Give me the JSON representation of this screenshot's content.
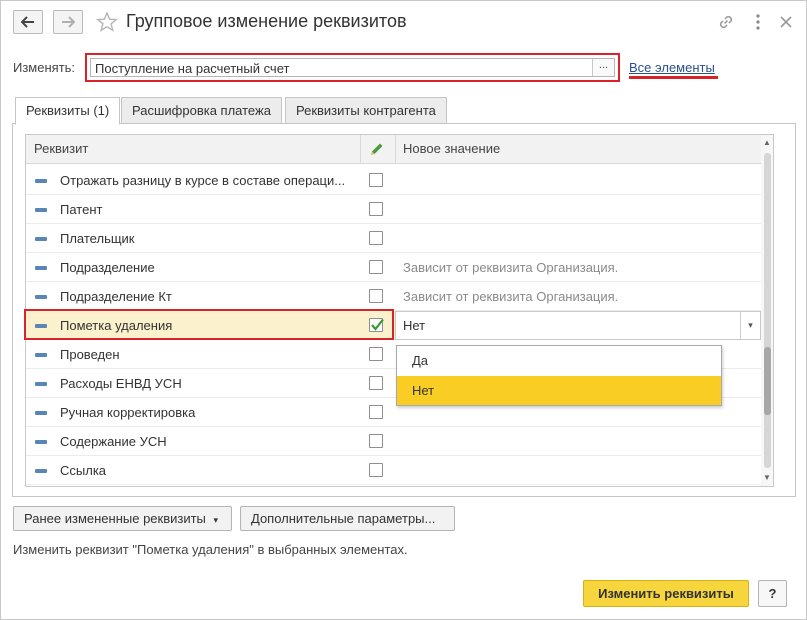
{
  "window": {
    "title": "Групповое изменение реквизитов"
  },
  "edit_row": {
    "label": "Изменять:",
    "value": "Поступление на расчетный счет",
    "choose_button": "...",
    "all_elements_link": "Все элементы"
  },
  "tabs": [
    {
      "label": "Реквизиты (1)",
      "active": true
    },
    {
      "label": "Расшифровка платежа",
      "active": false
    },
    {
      "label": "Реквизиты контрагента",
      "active": false
    }
  ],
  "table": {
    "columns": {
      "name": "Реквизит",
      "new_value": "Новое значение"
    },
    "rows": [
      {
        "name": "Отражать разницу в курсе в составе операци...",
        "checked": false,
        "value": ""
      },
      {
        "name": "Патент",
        "checked": false,
        "value": ""
      },
      {
        "name": "Плательщик",
        "checked": false,
        "value": ""
      },
      {
        "name": "Подразделение",
        "checked": false,
        "value": "Зависит от реквизита Организация."
      },
      {
        "name": "Подразделение Кт",
        "checked": false,
        "value": "Зависит от реквизита Организация."
      },
      {
        "name": "Пометка удаления",
        "checked": true,
        "value": "Нет"
      },
      {
        "name": "Проведен",
        "checked": false,
        "value": ""
      },
      {
        "name": "Расходы ЕНВД УСН",
        "checked": false,
        "value": ""
      },
      {
        "name": "Ручная корректировка",
        "checked": false,
        "value": ""
      },
      {
        "name": "Содержание УСН",
        "checked": false,
        "value": ""
      },
      {
        "name": "Ссылка",
        "checked": false,
        "value": ""
      }
    ]
  },
  "dropdown": {
    "options": [
      "Да",
      "Нет"
    ],
    "highlighted": "Нет"
  },
  "buttons": {
    "previous": "Ранее измененные реквизиты",
    "additional": "Дополнительные параметры...",
    "apply": "Изменить реквизиты",
    "help": "?"
  },
  "status_text": "Изменить реквизит \"Пометка удаления\" в выбранных элементах.",
  "colors": {
    "accent_yellow": "#f9cd23",
    "highlight_red": "#d9232b",
    "link_blue": "#2a4f8e",
    "selected_row": "#fbf1cc",
    "check_green": "#3a9a3a"
  }
}
